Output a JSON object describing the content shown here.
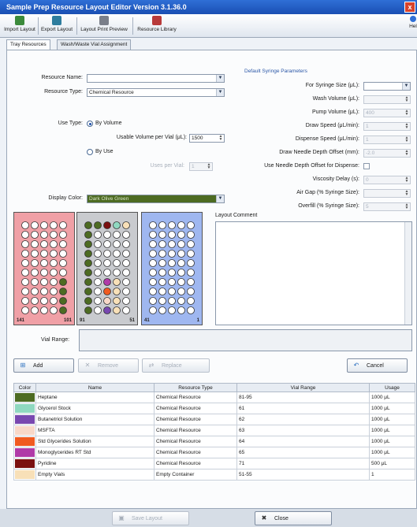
{
  "window": {
    "title": "Sample Prep Resource Layout Editor Version 3.1.36.0",
    "close_glyph": "x"
  },
  "toolbar": {
    "import_layout": "Import Layout",
    "export_layout": "Export Layout",
    "layout_print_preview": "Layout Print Preview",
    "resource_library": "Resource Library",
    "help": "Hel"
  },
  "tabs": [
    {
      "label": "Tray Resources"
    },
    {
      "label": "Wash/Waste Vial Assignment"
    }
  ],
  "form": {
    "resource_name_label": "Resource Name:",
    "resource_name_value": "",
    "resource_type_label": "Resource Type:",
    "resource_type_value": "Chemical Resource",
    "use_type_label": "Use Type:",
    "by_volume_label": "By Volume",
    "usable_volume_label": "Usable Volume per Vial (μL):",
    "usable_volume_value": "1500",
    "by_use_label": "By Use",
    "uses_per_vial_label": "Uses per Vial:",
    "uses_per_vial_value": "1",
    "display_color_label": "Display Color:",
    "display_color_value": "Dark Olive Green",
    "display_color_hex": "#4d6b22"
  },
  "syringe": {
    "group_title": "Default Syringe Parameters",
    "rows": [
      {
        "label": "For Syringe Size (μL):",
        "value": "",
        "kind": "dropdown",
        "enabled": true
      },
      {
        "label": "Wash Volume (μL):",
        "value": "",
        "kind": "spin",
        "enabled": false
      },
      {
        "label": "Pump Volume (μL):",
        "value": "400",
        "kind": "spin",
        "enabled": false
      },
      {
        "label": "Draw Speed (μL/min):",
        "value": "1",
        "kind": "spin",
        "enabled": false
      },
      {
        "label": "Dispense Speed (μL/min):",
        "value": "1",
        "kind": "spin",
        "enabled": false
      },
      {
        "label": "Draw Needle Depth Offset (mm):",
        "value": "-2.0",
        "kind": "spin",
        "enabled": false
      },
      {
        "label": "Use Needle Depth Offset for Dispense:",
        "value": "",
        "kind": "check",
        "enabled": true
      },
      {
        "label": "Viscosity Delay (s):",
        "value": "0",
        "kind": "spin",
        "enabled": false
      },
      {
        "label": "Air Gap (% Syringe Size):",
        "value": "",
        "kind": "spin",
        "enabled": false
      },
      {
        "label": "Overfill (% Syringe Size):",
        "value": "5",
        "kind": "spin",
        "enabled": false
      }
    ]
  },
  "trays": [
    {
      "start": "141",
      "end": "101",
      "color": "#f0a0a6"
    },
    {
      "start": "91",
      "end": "51",
      "color": "#c9cbcf"
    },
    {
      "start": "41",
      "end": "1",
      "color": "#9fb7f0"
    }
  ],
  "layout_comment_label": "Layout Comment",
  "vial_range_label": "Vial Range:",
  "buttons": {
    "add": "Add",
    "remove": "Remove",
    "replace": "Replace",
    "cancel": "Cancel",
    "save_layout": "Save Layout",
    "close": "Close"
  },
  "table": {
    "headers": [
      "Color",
      "Name",
      "Resource Type",
      "Vial Range",
      "Usage"
    ],
    "rows": [
      {
        "color": "#4d6b22",
        "name": "Heptane",
        "type": "Chemical Resource",
        "range": "81-95",
        "usage": "1000 μL"
      },
      {
        "color": "#8fd8c0",
        "name": "Glycerol Stock",
        "type": "Chemical Resource",
        "range": "61",
        "usage": "1000 μL"
      },
      {
        "color": "#7848b0",
        "name": "Butanetriol Solution",
        "type": "Chemical Resource",
        "range": "62",
        "usage": "1000 μL"
      },
      {
        "color": "#f8d8c8",
        "name": "MSFTA",
        "type": "Chemical Resource",
        "range": "63",
        "usage": "1000 μL"
      },
      {
        "color": "#f05a20",
        "name": "Std Glycerides Solution",
        "type": "Chemical Resource",
        "range": "64",
        "usage": "1000 μL"
      },
      {
        "color": "#b03aa8",
        "name": "Monoglycerides RT Std",
        "type": "Chemical Resource",
        "range": "65",
        "usage": "1000 μL"
      },
      {
        "color": "#7a1010",
        "name": "Pyridine",
        "type": "Chemical Resource",
        "range": "71",
        "usage": "500 μL"
      },
      {
        "color": "#f8e0b8",
        "name": "Empty Vials",
        "type": "Empty Container",
        "range": "51-55",
        "usage": "1"
      }
    ]
  }
}
